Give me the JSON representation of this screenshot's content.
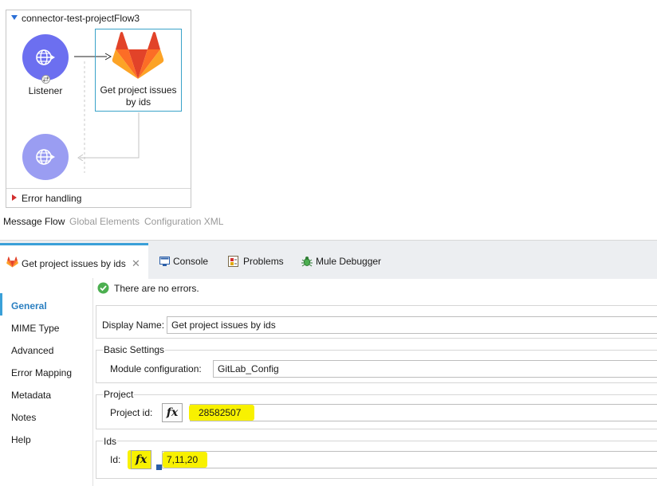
{
  "flow": {
    "title": "connector-test-projectFlow3",
    "listener_label": "Listener",
    "gitlab_label_line1": "Get project issues",
    "gitlab_label_line2": "by ids",
    "error_handling": "Error handling"
  },
  "editor_tabs": [
    "Message Flow",
    "Global Elements",
    "Configuration XML"
  ],
  "view_tabs": {
    "properties": "Get project issues by ids",
    "console": "Console",
    "problems": "Problems",
    "debugger": "Mule Debugger"
  },
  "nav": [
    "General",
    "MIME Type",
    "Advanced",
    "Error Mapping",
    "Metadata",
    "Notes",
    "Help"
  ],
  "status": "There are no errors.",
  "form": {
    "display_name_label": "Display Name:",
    "display_name_value": "Get project issues by ids",
    "basic_settings_title": "Basic Settings",
    "module_config_label": "Module configuration:",
    "module_config_value": "GitLab_Config",
    "project_title": "Project",
    "project_id_label": "Project id:",
    "project_id_value": "28582507",
    "ids_title": "Ids",
    "id_label": "Id:",
    "id_value": "7,11,20",
    "fx_label": "fx"
  },
  "colors": {
    "accent": "#3aa0d8",
    "flow_node": "#6c6ff0",
    "highlight": "#f8f100",
    "gitlab_orange": "#fc6d26"
  }
}
